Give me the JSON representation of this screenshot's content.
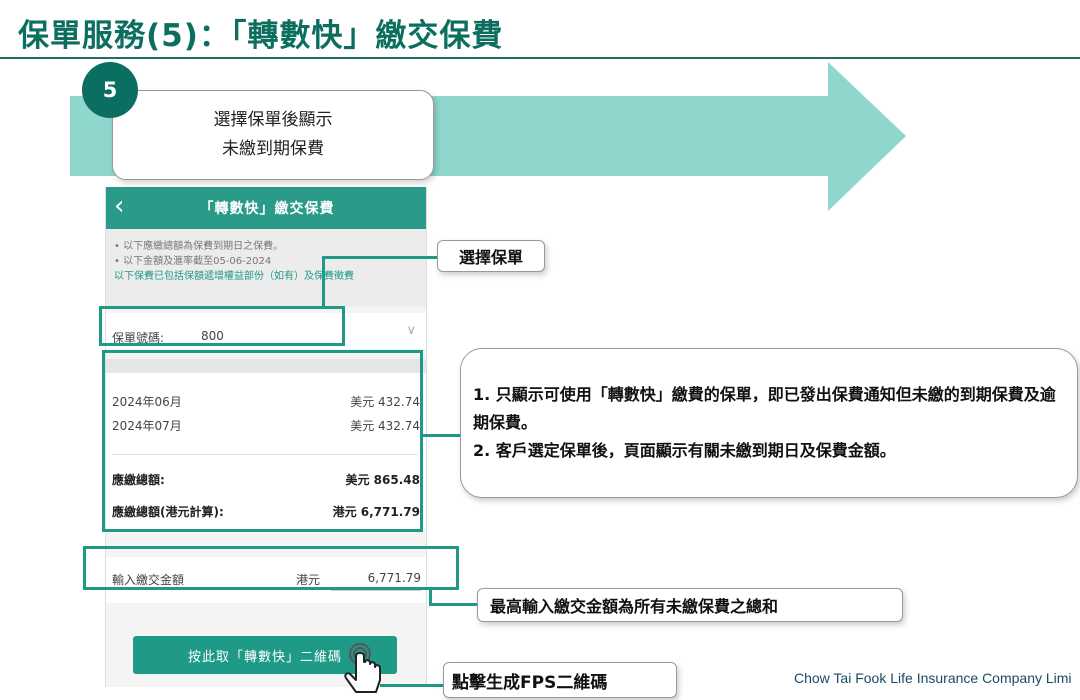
{
  "slide": {
    "title": "保單服務(5)：「轉數快」繳交保費",
    "step_number": "5",
    "step_line1": "選擇保單後顯示",
    "step_line2": "未繳到期保費",
    "footer": "Chow Tai Fook Life Insurance Company Limi",
    "colors": {
      "brand_green": "#0a6e60",
      "accent_green": "#1f9a87",
      "arrow_teal": "#8fd6cc"
    }
  },
  "phone": {
    "back_icon": "chevron-left-icon",
    "header_title": "「轉數快」繳交保費",
    "note1": "• 以下應繳總額為保費到期日之保費。",
    "note2": "• 以下金額及滙率截至05-06-2024",
    "note3": "以下保費已包括保額遞增權益部份（如有）及保費徵費",
    "policy_label": "保單號碼:",
    "policy_value": "800",
    "dues": [
      {
        "month": "2024年06月",
        "amount": "美元 432.74"
      },
      {
        "month": "2024年07月",
        "amount": "美元 432.74"
      }
    ],
    "total_label": "應繳總額:",
    "total_value": "美元 865.48",
    "total_hkd_label": "應繳總額(港元計算):",
    "total_hkd_value": "港元 6,771.79",
    "input_label": "輸入繳交金額",
    "input_currency": "港元",
    "input_value": "6,771.79",
    "button_label": "按此取「轉數快」二維碼"
  },
  "callouts": {
    "select_policy": "選擇保單",
    "info_line1": "1. 只顯示可使用「轉數快」繳費的保單，即已發出保費通知但未繳的到期保費及逾期保費。",
    "info_line2": "2. 客戶選定保單後，頁面顯示有關未繳到期日及保費金額。",
    "max_amount": "最高輸入繳交金額為所有未繳保費之總和",
    "generate_fps": "點擊生成FPS二維碼"
  }
}
